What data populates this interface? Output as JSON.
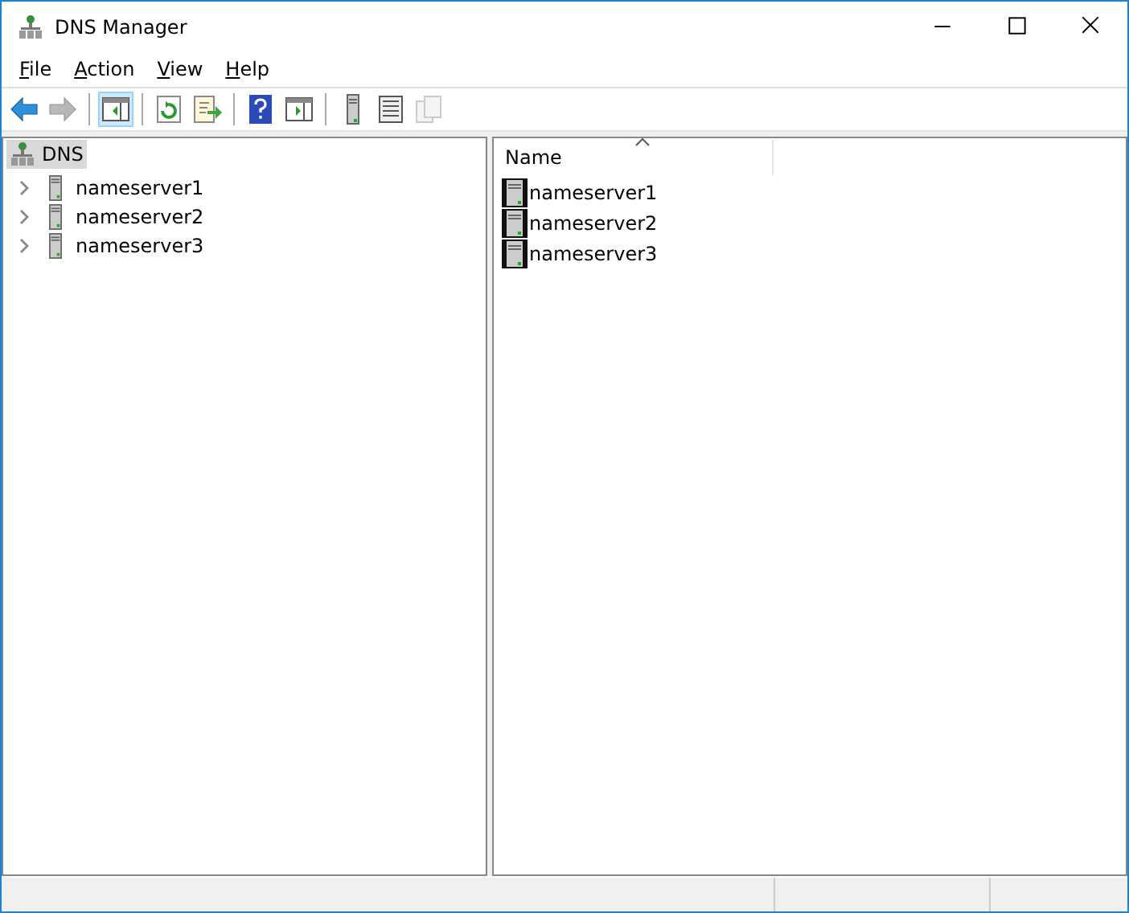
{
  "window": {
    "title": "DNS Manager"
  },
  "menu": [
    "File",
    "Action",
    "View",
    "Help"
  ],
  "toolbar": [
    {
      "kind": "back",
      "disabled": false,
      "selected": false
    },
    {
      "kind": "forward",
      "disabled": true,
      "selected": false
    },
    {
      "kind": "sep"
    },
    {
      "kind": "console-tree",
      "disabled": false,
      "selected": true
    },
    {
      "kind": "sep"
    },
    {
      "kind": "refresh",
      "disabled": false,
      "selected": false
    },
    {
      "kind": "export",
      "disabled": false,
      "selected": false
    },
    {
      "kind": "sep"
    },
    {
      "kind": "help",
      "disabled": false,
      "selected": false
    },
    {
      "kind": "action-pane",
      "disabled": false,
      "selected": false
    },
    {
      "kind": "sep"
    },
    {
      "kind": "server",
      "disabled": false,
      "selected": false
    },
    {
      "kind": "list",
      "disabled": false,
      "selected": false
    },
    {
      "kind": "copy",
      "disabled": true,
      "selected": false
    }
  ],
  "tree": {
    "label": "DNS",
    "selected": true,
    "children": [
      {
        "label": "nameserver1",
        "expanded": false
      },
      {
        "label": "nameserver2",
        "expanded": false
      },
      {
        "label": "nameserver3",
        "expanded": false
      }
    ]
  },
  "list": {
    "columns": [
      "Name"
    ],
    "rows": [
      "nameserver1",
      "nameserver2",
      "nameserver3"
    ]
  }
}
